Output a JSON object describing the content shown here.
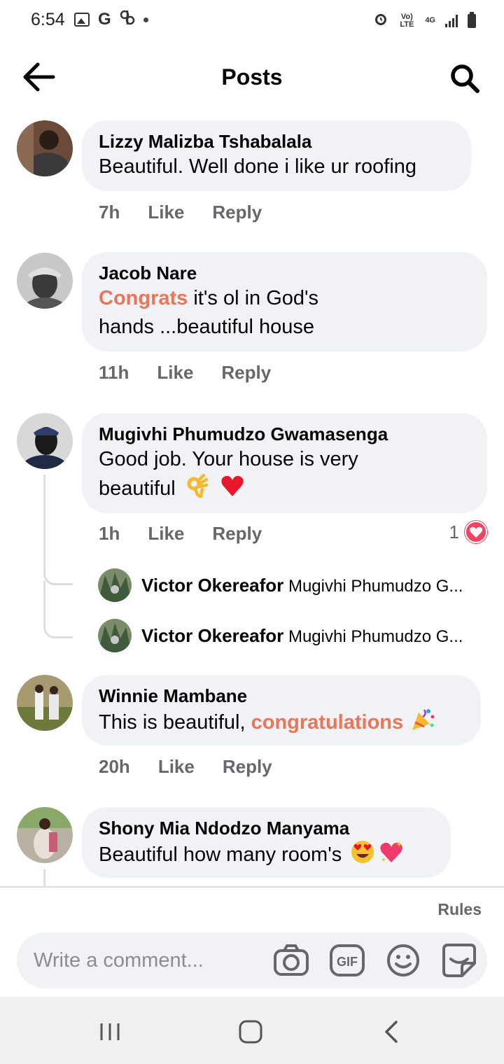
{
  "status_bar": {
    "time": "6:54",
    "network_label": "Vo) LTE",
    "signal_label": "4G"
  },
  "header": {
    "title": "Posts"
  },
  "comments": [
    {
      "author": "Lizzy Malizba Tshabalala",
      "text_parts": [
        "Beautiful. Well done i like ur roofing"
      ],
      "time": "7h",
      "like_label": "Like",
      "reply_label": "Reply"
    },
    {
      "author": "Jacob Nare",
      "text_highlight": "Congrats",
      "text_line1": " it's ol in God's",
      "text_line2": "hands ...beautiful house",
      "time": "11h",
      "like_label": "Like",
      "reply_label": "Reply"
    },
    {
      "author": "Mugivhi Phumudzo Gwamasenga",
      "text_line1": "Good job. Your house is very",
      "text_line2": "beautiful",
      "emojis": [
        "ok-hand",
        "red-heart"
      ],
      "time": "1h",
      "like_label": "Like",
      "reply_label": "Reply",
      "reaction_count": "1",
      "replies": [
        {
          "author": "Victor Okereafor",
          "text": "Mugivhi Phumudzo G..."
        },
        {
          "author": "Victor Okereafor",
          "text": "Mugivhi Phumudzo G..."
        }
      ]
    },
    {
      "author": "Winnie Mambane",
      "text_plain": "This is beautiful, ",
      "text_highlight": "congratulations",
      "emojis": [
        "party-popper"
      ],
      "time": "20h",
      "like_label": "Like",
      "reply_label": "Reply"
    },
    {
      "author": "Shony Mia Ndodzo Manyama",
      "text_plain": "Beautiful how many room's",
      "emojis": [
        "heart-eyes",
        "sparkling-heart"
      ]
    }
  ],
  "composer": {
    "rules_label": "Rules",
    "placeholder": "Write a comment...",
    "gif_label": "GIF"
  },
  "colors": {
    "highlight": "#e8765a",
    "bubble": "#f0f2f5",
    "secondary_text": "#65676b",
    "heart": "#f3425f"
  }
}
